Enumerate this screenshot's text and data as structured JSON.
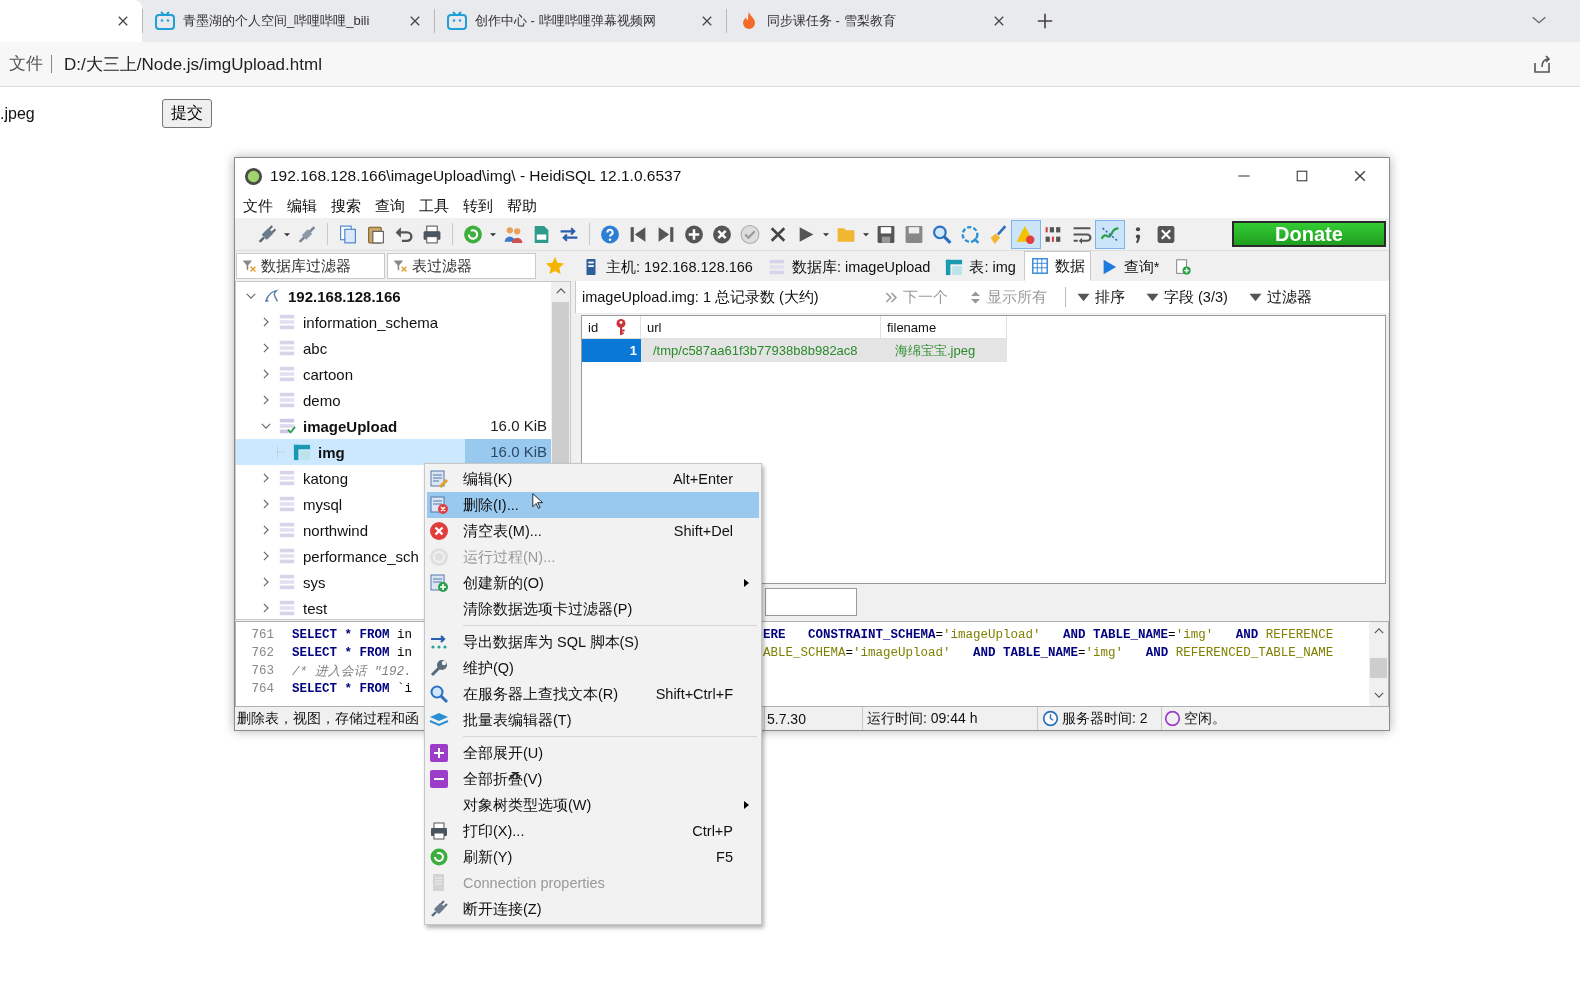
{
  "browser": {
    "tabs": [
      {
        "selected": true
      },
      {
        "title": "青墨湖的个人空间_哔哩哔哩_bili",
        "selected": false
      },
      {
        "title": "创作中心 - 哔哩哔哩弹幕视频网",
        "selected": false
      },
      {
        "title": "同步课任务 - 雪梨教育",
        "selected": false
      }
    ],
    "address": {
      "scheme": "文件",
      "url": "D:/大三上/Node.js/imgUpload.html"
    }
  },
  "page": {
    "file_name": ".jpeg",
    "submit": "提交"
  },
  "window": {
    "title": "192.168.128.166\\imageUpload\\img\\ - HeidiSQL 12.1.0.6537"
  },
  "menubar": [
    "文件",
    "编辑",
    "搜索",
    "查询",
    "工具",
    "转到",
    "帮助"
  ],
  "toolbar_toggles": [
    {
      "on": true
    },
    {
      "on": true
    }
  ],
  "donate": "Donate",
  "filters": [
    {
      "placeholder": "数据库过滤器"
    },
    {
      "placeholder": "表过滤器"
    }
  ],
  "tabs": [
    {
      "label": "主机: 192.168.128.166",
      "selected": false
    },
    {
      "label": "数据库: imageUpload",
      "selected": false
    },
    {
      "label": "表: img",
      "selected": false
    },
    {
      "label": "数据",
      "selected": true
    },
    {
      "label": "查询*",
      "selected": false
    }
  ],
  "data_bar": {
    "summary": "imageUpload.img: 1 总记录数 (大约)",
    "buttons": [
      {
        "label": "下一个",
        "disabled": true
      },
      {
        "label": "显示所有",
        "disabled": true
      },
      {
        "label": "排序",
        "disabled": false
      },
      {
        "label": "字段 (3/3)",
        "disabled": false
      },
      {
        "label": "过滤器",
        "disabled": false
      }
    ]
  },
  "grid": {
    "columns": [
      {
        "label": "id",
        "primary_key": true
      },
      {
        "label": "url",
        "primary_key": false
      },
      {
        "label": "filename",
        "primary_key": false
      }
    ],
    "rows": [
      {
        "selected": true,
        "cells": [
          "1",
          "/tmp/c587aa61f3b77938b8b982ac8",
          "海绵宝宝.jpeg"
        ]
      }
    ]
  },
  "tree": {
    "kind": "server",
    "label": "192.168.128.166",
    "expanded": true,
    "selected": false,
    "active": true,
    "children": [
      {
        "kind": "database",
        "label": "information_schema",
        "expanded": false,
        "selected": false,
        "active": false
      },
      {
        "kind": "database",
        "label": "abc",
        "expanded": false,
        "selected": false,
        "active": false
      },
      {
        "kind": "database",
        "label": "cartoon",
        "expanded": false,
        "selected": false,
        "active": false
      },
      {
        "kind": "database",
        "label": "demo",
        "expanded": false,
        "selected": false,
        "active": false
      },
      {
        "kind": "database",
        "label": "imageUpload",
        "size": "16.0 KiB",
        "expanded": true,
        "selected": false,
        "active": true,
        "children": [
          {
            "kind": "table",
            "label": "img",
            "size": "16.0 KiB",
            "selected": true,
            "active": true
          }
        ]
      },
      {
        "kind": "database",
        "label": "katong",
        "expanded": false,
        "selected": false,
        "active": false
      },
      {
        "kind": "database",
        "label": "mysql",
        "expanded": false,
        "selected": false,
        "active": false
      },
      {
        "kind": "database",
        "label": "northwind",
        "expanded": false,
        "selected": false,
        "active": false
      },
      {
        "kind": "database",
        "label": "performance_sch",
        "expanded": false,
        "selected": false,
        "active": false
      },
      {
        "kind": "database",
        "label": "sys",
        "expanded": false,
        "selected": false,
        "active": false
      },
      {
        "kind": "database",
        "label": "test",
        "expanded": false,
        "selected": false,
        "active": false
      }
    ]
  },
  "log": [
    {
      "number": "761",
      "left": [
        {
          "kind": "keyword",
          "text": "SELECT * FROM"
        },
        {
          "kind": "plain",
          "text": " in"
        }
      ],
      "right": [
        {
          "kind": "keyword",
          "text": "ERE   CONSTRAINT_SCHEMA"
        },
        {
          "kind": "plain",
          "text": "="
        },
        {
          "kind": "string",
          "text": "'imageUpload'"
        },
        {
          "kind": "keyword",
          "text": "   AND TABLE_NAME"
        },
        {
          "kind": "plain",
          "text": "="
        },
        {
          "kind": "string",
          "text": "'img'"
        },
        {
          "kind": "keyword",
          "text": "   AND "
        },
        {
          "kind": "field",
          "text": "REFERENCE"
        }
      ]
    },
    {
      "number": "762",
      "left": [
        {
          "kind": "keyword",
          "text": "SELECT * FROM"
        },
        {
          "kind": "plain",
          "text": " in"
        }
      ],
      "right": [
        {
          "kind": "field",
          "text": "ABLE_SCHEMA"
        },
        {
          "kind": "plain",
          "text": "="
        },
        {
          "kind": "string",
          "text": "'imageUpload'"
        },
        {
          "kind": "keyword",
          "text": "   AND TABLE_NAME"
        },
        {
          "kind": "plain",
          "text": "="
        },
        {
          "kind": "string",
          "text": "'img'"
        },
        {
          "kind": "keyword",
          "text": "   AND "
        },
        {
          "kind": "field",
          "text": "REFERENCED_TABLE_NAME"
        }
      ]
    },
    {
      "number": "763",
      "left": [
        {
          "kind": "comment",
          "text": "/* 进入会话 \"192."
        }
      ]
    },
    {
      "number": "764",
      "left": [
        {
          "kind": "keyword",
          "text": "SELECT * FROM"
        },
        {
          "kind": "plain",
          "text": " `i"
        }
      ]
    }
  ],
  "status_bar": [
    "删除表，视图，存储过程和函",
    "5.7.30",
    "运行时间: 09:44 h",
    "服务器时间: 2",
    "空闲。"
  ],
  "context_menu": [
    {
      "kind": "item",
      "label": "编辑(K)",
      "shortcut": "Alt+Enter",
      "disabled": false,
      "selected": false,
      "submenu": false
    },
    {
      "kind": "item",
      "label": "删除(I)...",
      "disabled": false,
      "selected": true,
      "submenu": false
    },
    {
      "kind": "item",
      "label": "清空表(M)...",
      "shortcut": "Shift+Del",
      "disabled": false,
      "selected": false,
      "submenu": false
    },
    {
      "kind": "item",
      "label": "运行过程(N)...",
      "disabled": true,
      "selected": false,
      "submenu": false
    },
    {
      "kind": "item",
      "label": "创建新的(O)",
      "disabled": false,
      "selected": false,
      "submenu": true
    },
    {
      "kind": "item",
      "label": "清除数据选项卡过滤器(P)",
      "disabled": false,
      "selected": false,
      "submenu": false
    },
    {
      "kind": "separator"
    },
    {
      "kind": "item",
      "label": "导出数据库为 SQL 脚本(S)",
      "disabled": false,
      "selected": false,
      "submenu": false
    },
    {
      "kind": "item",
      "label": "维护(Q)",
      "disabled": false,
      "selected": false,
      "submenu": false
    },
    {
      "kind": "item",
      "label": "在服务器上查找文本(R)",
      "shortcut": "Shift+Ctrl+F",
      "disabled": false,
      "selected": false,
      "submenu": false
    },
    {
      "kind": "item",
      "label": "批量表编辑器(T)",
      "disabled": false,
      "selected": false,
      "submenu": false
    },
    {
      "kind": "separator"
    },
    {
      "kind": "item",
      "label": "全部展开(U)",
      "disabled": false,
      "selected": false,
      "submenu": false
    },
    {
      "kind": "item",
      "label": "全部折叠(V)",
      "disabled": false,
      "selected": false,
      "submenu": false
    },
    {
      "kind": "item",
      "label": "对象树类型选项(W)",
      "disabled": false,
      "selected": false,
      "submenu": true
    },
    {
      "kind": "item",
      "label": "打印(X)...",
      "shortcut": "Ctrl+P",
      "disabled": false,
      "selected": false,
      "submenu": false
    },
    {
      "kind": "item",
      "label": "刷新(Y)",
      "shortcut": "F5",
      "disabled": false,
      "selected": false,
      "submenu": false
    },
    {
      "kind": "item",
      "label": "Connection properties",
      "disabled": true,
      "selected": false,
      "submenu": false
    },
    {
      "kind": "item",
      "label": "断开连接(Z)",
      "disabled": false,
      "selected": false,
      "submenu": false
    }
  ]
}
